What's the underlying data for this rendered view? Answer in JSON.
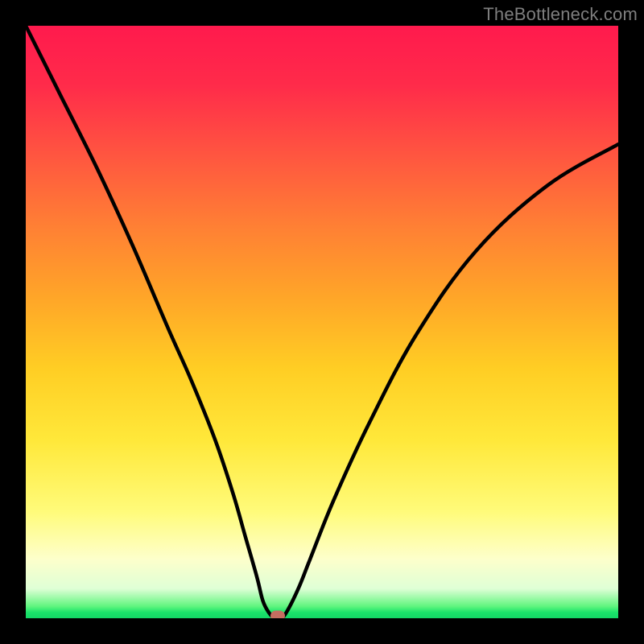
{
  "watermark": "TheBottleneck.com",
  "colors": {
    "curve": "#000000",
    "marker": "#c56e60",
    "frame": "#000000"
  },
  "chart_data": {
    "type": "line",
    "title": "",
    "xlabel": "",
    "ylabel": "",
    "xlim": [
      0,
      100
    ],
    "ylim": [
      0,
      100
    ],
    "grid": false,
    "legend": false,
    "series": [
      {
        "name": "bottleneck-curve",
        "x": [
          0,
          6,
          12,
          18,
          24,
          28,
          32,
          35,
          37,
          39,
          40,
          41,
          42,
          43,
          44,
          46,
          48,
          52,
          58,
          66,
          76,
          88,
          100
        ],
        "values": [
          100,
          88,
          76,
          63,
          49,
          40,
          30,
          21,
          14,
          7,
          3,
          1,
          0,
          0,
          1,
          5,
          10,
          20,
          33,
          48,
          62,
          73,
          80
        ]
      }
    ],
    "marker": {
      "x": 42.5,
      "y": 0
    },
    "background_gradient": {
      "top": "#ff1a4d",
      "bottom": "#14d866"
    }
  }
}
